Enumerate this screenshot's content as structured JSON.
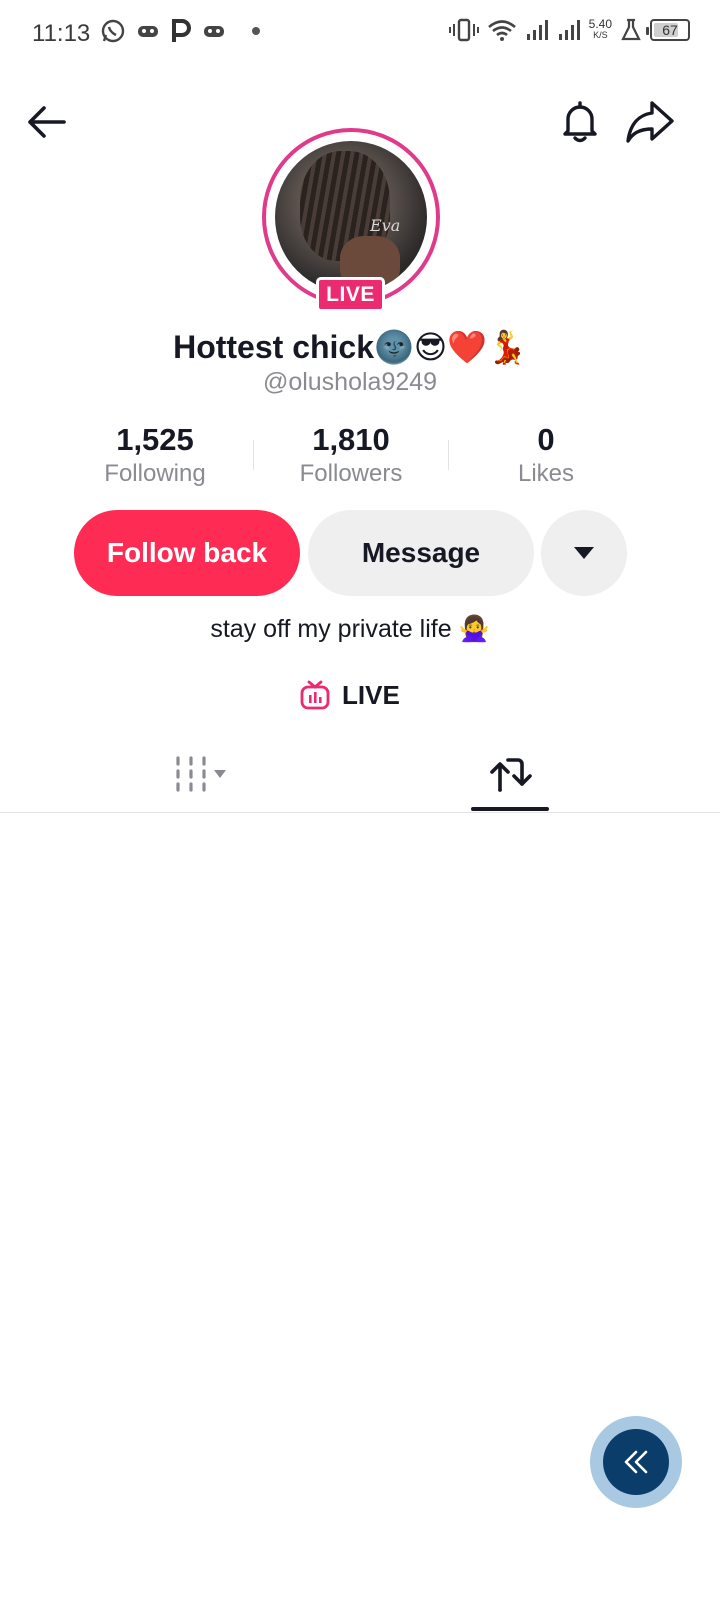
{
  "status_bar": {
    "time": "11:13",
    "network_speed_value": "5.40",
    "network_speed_unit": "K/S",
    "battery_level": "67",
    "icons": [
      "whatsapp-icon",
      "game-controller-icon",
      "parking-icon",
      "game-controller-icon",
      "dot-icon",
      "vibrate-icon",
      "wifi-icon",
      "signal-icon",
      "signal-icon",
      "flask-icon",
      "battery-icon"
    ]
  },
  "nav": {
    "icons": [
      "back-arrow-icon",
      "bell-icon",
      "share-icon"
    ]
  },
  "profile": {
    "live_badge": "LIVE",
    "display_name": "Hottest chick🌚😎❤️💃",
    "username": "@olushola9249",
    "avatar_caption": "Eva"
  },
  "stats": [
    {
      "value": "1,525",
      "label": "Following"
    },
    {
      "value": "1,810",
      "label": "Followers"
    },
    {
      "value": "0",
      "label": "Likes"
    }
  ],
  "actions": {
    "follow_back": "Follow back",
    "message": "Message"
  },
  "bio": "stay off my private life 🙅‍♀️",
  "live_link": {
    "label": "LIVE"
  },
  "tabs": {
    "active": "reposts"
  },
  "colors": {
    "primary": "#fe2c55",
    "live_badge": "#ec2a6f",
    "float_button": "#0b3d6b"
  }
}
